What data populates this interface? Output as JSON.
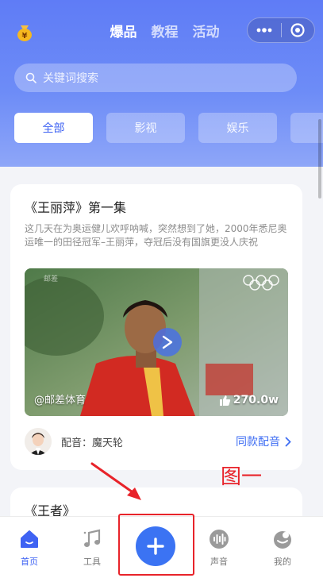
{
  "header": {
    "tabs": [
      {
        "label": "爆品",
        "active": true
      },
      {
        "label": "教程",
        "active": false
      },
      {
        "label": "活动",
        "active": false
      }
    ],
    "capsule": {
      "more_icon": "more-dots-icon",
      "target_icon": "target-icon"
    }
  },
  "search": {
    "placeholder": "关键词搜索"
  },
  "categories": [
    {
      "label": "全部",
      "active": true
    },
    {
      "label": "影视",
      "active": false
    },
    {
      "label": "娱乐",
      "active": false
    },
    {
      "label": "",
      "active": false
    }
  ],
  "card1": {
    "title": "《王丽萍》第一集",
    "description": "这几天在为奥运健儿欢呼呐喊，突然想到了她，2000年悉尼奥运唯一的田径冠军–王丽萍，夺冠后没有国旗更没人庆祝",
    "video": {
      "author": "@邮差体育",
      "likes": "270.0w"
    },
    "dubber_label": "配音：魔天轮",
    "same_dub_label": "同款配音"
  },
  "card2": {
    "title": "《王者》"
  },
  "annotation": {
    "text": "图一"
  },
  "bottom_nav": {
    "items": [
      {
        "label": "首页",
        "active": true
      },
      {
        "label": "工具",
        "active": false
      },
      {
        "label": "声音",
        "active": false
      },
      {
        "label": "我的",
        "active": false
      }
    ]
  },
  "colors": {
    "accent": "#3f63f3",
    "annotation": "#e8232a"
  }
}
